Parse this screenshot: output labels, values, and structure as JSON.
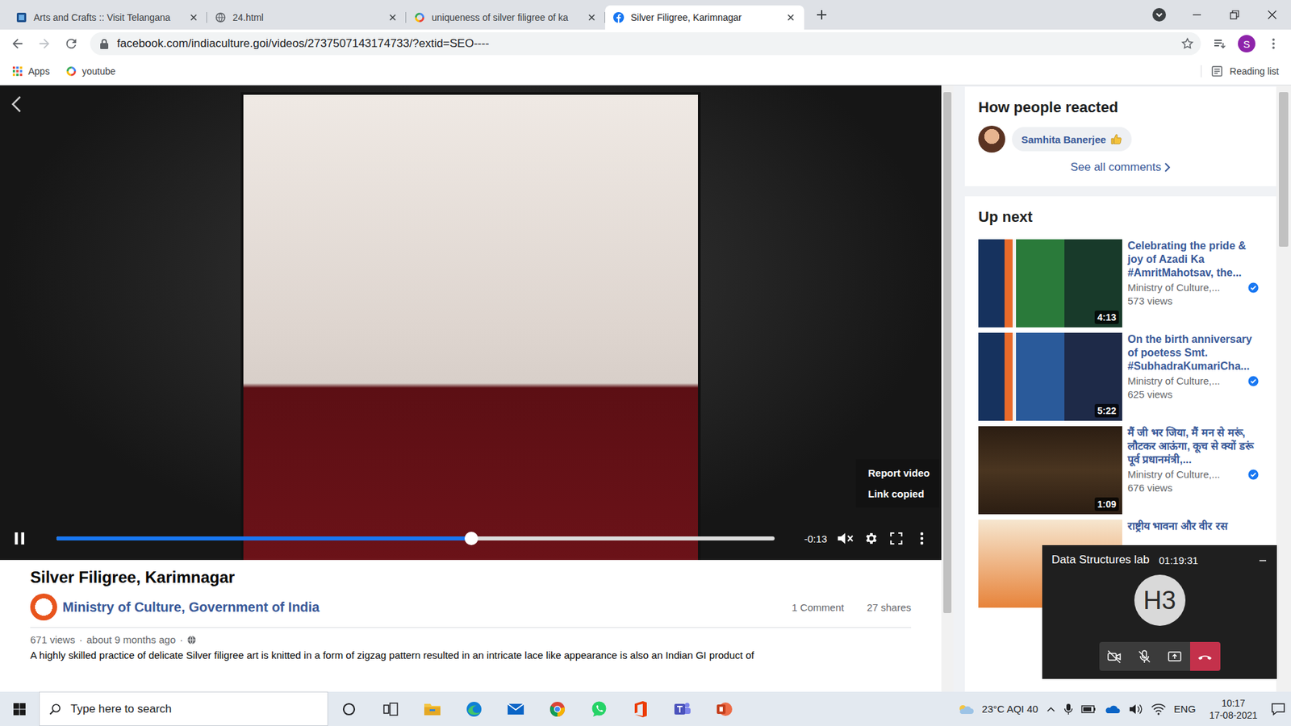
{
  "browser": {
    "tabs": [
      {
        "label": "Arts and Crafts :: Visit Telangana",
        "selected": false
      },
      {
        "label": "24.html",
        "selected": false
      },
      {
        "label": "uniqueness of silver filigree of ka",
        "selected": false
      },
      {
        "label": "Silver Filigree, Karimnagar",
        "selected": true
      }
    ],
    "url": "facebook.com/indiaculture.goi/videos/2737507143174733/?extid=SEO----",
    "profile_initial": "S",
    "bookmarks": [
      {
        "label": "Apps"
      },
      {
        "label": "youtube"
      }
    ],
    "reading_list": "Reading list"
  },
  "video": {
    "playing": true,
    "progress": {
      "level": 0.578
    },
    "time": "-0:13",
    "muted": true,
    "menu": [
      {
        "label": "Report video"
      },
      {
        "label": "Link copied"
      }
    ]
  },
  "post": {
    "title": "Silver Filigree, Karimnagar",
    "page": "Ministry of Culture, Government of India",
    "comments": "1 Comment",
    "shares": "27 shares",
    "views": "671 views",
    "separator": "·",
    "age": "about 9 months ago",
    "description": "A highly skilled practice of delicate Silver filigree art is knitted in a form of zigzag pattern resulted in an intricate lace like appearance is also an Indian GI product of"
  },
  "reactions": {
    "heading": "How people reacted",
    "people": [
      {
        "name": "Samhita Banerjee"
      }
    ],
    "see_all": "See all comments"
  },
  "up_next": {
    "heading": "Up next",
    "items": [
      {
        "title": "Celebrating the pride & joy of Azadi Ka #AmritMahotsav, the...",
        "channel": "Ministry of Culture,...",
        "views": "573 views",
        "duration": "4:13",
        "verified": true
      },
      {
        "title": "On the birth anniversary of poetess Smt. #SubhadraKumariCha...",
        "channel": "Ministry of Culture,...",
        "views": "625 views",
        "duration": "5:22",
        "verified": true
      },
      {
        "title": "मैं जी भर जिया, मैं मन से मरूं, लौटकर आऊंगा, कूच से क्यों डरूं पूर्व प्रधानमंत्री,...",
        "channel": "Ministry of Culture,...",
        "views": "676 views",
        "duration": "1:09",
        "verified": true
      },
      {
        "title": "राष्ट्रीय भावना और वीर रस"
      }
    ]
  },
  "teams": {
    "title": "Data Structures lab",
    "time": "01:19:31",
    "avatar": "H3",
    "camera_on": false,
    "mic_on": false
  },
  "taskbar": {
    "search_placeholder": "Type here to search",
    "weather": "23°C AQI 40",
    "language": "ENG",
    "time": "10:17",
    "date": "17-08-2021"
  }
}
